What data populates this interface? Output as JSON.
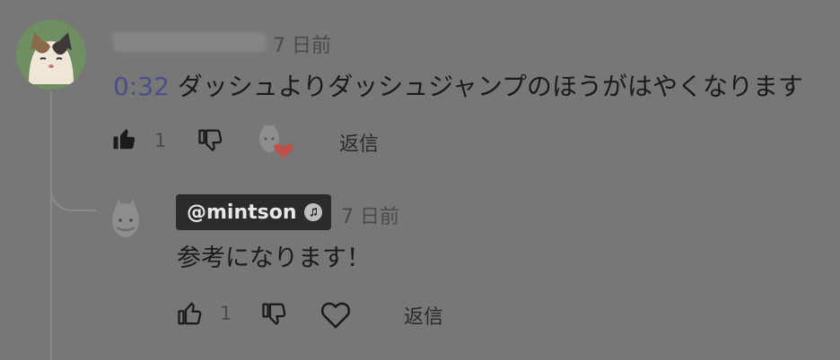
{
  "comment": {
    "author_name": "@hankamikasa",
    "time": "7 日前",
    "timestamp_link": "0:32",
    "text": " ダッシュよりダッシュジャンプのほうがはやくなります",
    "like_count": "1",
    "reply_label": "返信"
  },
  "reply": {
    "author_name": "@mintson",
    "time": "7 日前",
    "text": "参考になります！",
    "like_count": "1",
    "reply_label": "返信"
  },
  "icons": {
    "like_filled": "thumbs-up-filled-icon",
    "dislike": "thumbs-down-icon",
    "creator_heart": "creator-heart-icon",
    "like_outline": "thumbs-up-icon",
    "heart_outline": "heart-icon",
    "verified": "music-note-verified-icon"
  },
  "colors": {
    "timestamp_link": "#4a4f8a",
    "heart": "#c0504a",
    "badge_bg": "#2b2b2b"
  }
}
